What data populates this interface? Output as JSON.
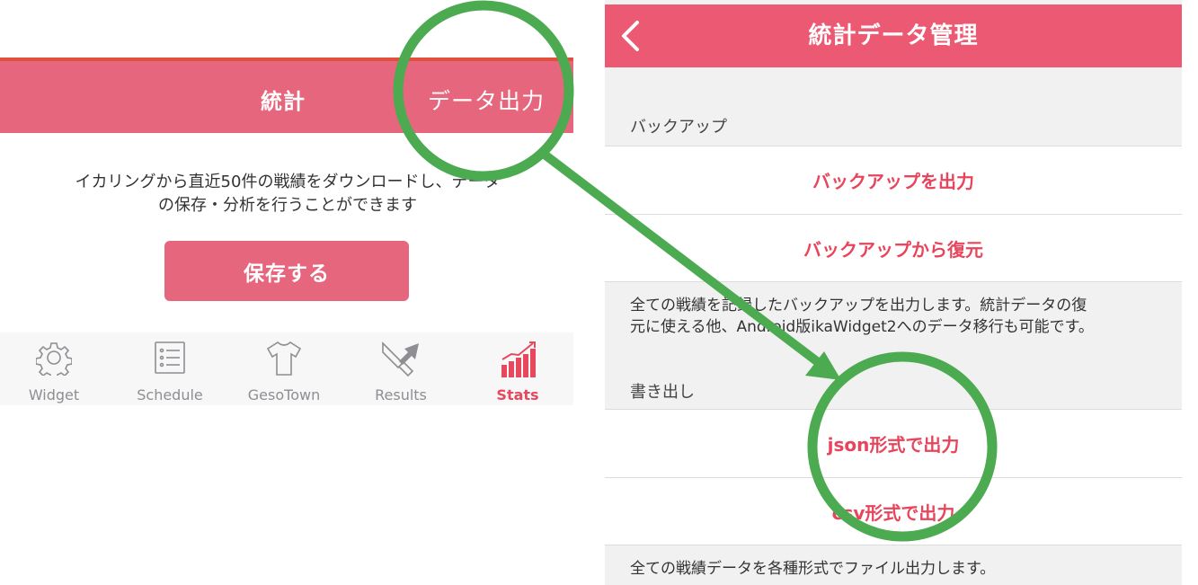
{
  "left": {
    "tabs": {
      "stats": "統計",
      "export": "データ出力"
    },
    "description_line1": "イカリングから直近50件の戦績をダウンロードし、データ",
    "description_line2": "の保存・分析を行うことができます",
    "save_button": "保存する",
    "tabbar": [
      {
        "label": "Widget",
        "icon": "gear-icon"
      },
      {
        "label": "Schedule",
        "icon": "list-icon"
      },
      {
        "label": "GesoTown",
        "icon": "shirt-icon"
      },
      {
        "label": "Results",
        "icon": "weapons-icon"
      },
      {
        "label": "Stats",
        "icon": "bar-chart-icon",
        "active": true
      }
    ]
  },
  "right": {
    "title": "統計データ管理",
    "backup_section": "バックアップ",
    "backup_export": "バックアップを出力",
    "backup_restore": "バックアップから復元",
    "backup_note_line1": "全ての戦績を記録したバックアップを出力します。統計データの復",
    "backup_note_line2": "元に使える他、Android版ikaWidget2へのデータ移行も可能です。",
    "export_section": "書き出し",
    "export_json": "json形式で出力",
    "export_csv": "csv形式で出力",
    "export_note": "全ての戦績データを各種形式でファイル出力します。"
  },
  "colors": {
    "accent": "#eb5a72",
    "annotation": "#4caa50",
    "active_text": "#e6495e"
  }
}
